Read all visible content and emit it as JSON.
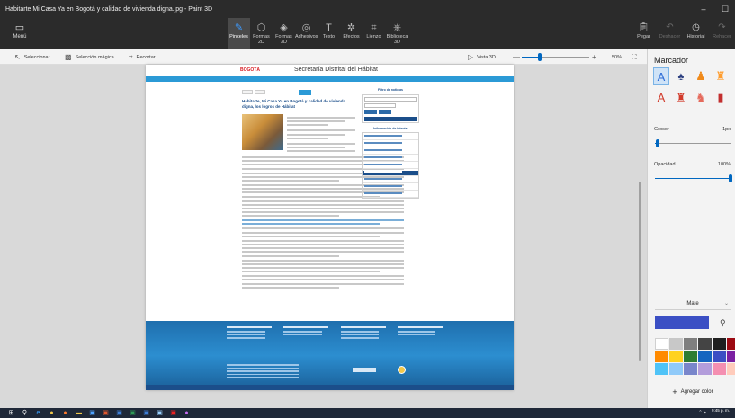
{
  "window": {
    "title": "Habitarte  Mi Casa Ya en Bogotá y calidad de vivienda digna.jpg - Paint 3D"
  },
  "ribbon": {
    "menu_label": "Menú",
    "tools": [
      {
        "label": "Pinceles",
        "icon": "brush-icon"
      },
      {
        "label": "Formas 2D",
        "icon": "shapes-2d-icon"
      },
      {
        "label": "Formas 3D",
        "icon": "shapes-3d-icon"
      },
      {
        "label": "Adhesivos",
        "icon": "stickers-icon"
      },
      {
        "label": "Texto",
        "icon": "text-icon"
      },
      {
        "label": "Efectos",
        "icon": "effects-icon"
      },
      {
        "label": "Lienzo",
        "icon": "canvas-icon"
      },
      {
        "label": "Biblioteca 3D",
        "icon": "library-3d-icon"
      }
    ],
    "right_tools": [
      {
        "label": "Pegar",
        "icon": "paste-icon"
      },
      {
        "label": "Deshacer",
        "icon": "undo-icon"
      },
      {
        "label": "Historial",
        "icon": "history-icon"
      },
      {
        "label": "Rehacer",
        "icon": "redo-icon"
      }
    ]
  },
  "selection_bar": {
    "select_label": "Seleccionar",
    "magic_select_label": "Selección mágica",
    "crop_label": "Recortar",
    "view_3d_label": "Vista 3D",
    "zoom_level": "50%",
    "zoom_fraction": 0.27
  },
  "canvas_image": {
    "logo_text": "BOGOTÁ",
    "secretaria": "Secretaría Distrital del Hábitat",
    "article_title": "Habitarte, Mi Casa Ya en Bogotá y calidad de vivienda digna, los logros de Hábitat",
    "sidebar_title": "Filtro de noticias",
    "info_title": "Información de interés"
  },
  "panel": {
    "title": "Marcador",
    "grosor_label": "Grosor",
    "grosor_value": "1px",
    "grosor_fraction": 0.04,
    "opacidad_label": "Opacidad",
    "opacidad_value": "100%",
    "opacidad_fraction": 1.0,
    "finish_label": "Mate",
    "current_color": "#3b4fc4",
    "add_color_label": "Agregar color",
    "swatches": [
      "#ffffff",
      "#c8c8c8",
      "#7f7f7f",
      "#444444",
      "#1f1f1f",
      "#9c0a12",
      "#ff8a00",
      "#ffd21f",
      "#2e7d32",
      "#1565c0",
      "#3b4fc4",
      "#7b1fa2",
      "#4fc3f7",
      "#90caf9",
      "#7986cb",
      "#b39ddb",
      "#f48fb1",
      "#ffccbc"
    ]
  },
  "taskbar": {
    "time": "9:45 p. m.",
    "date": ""
  }
}
